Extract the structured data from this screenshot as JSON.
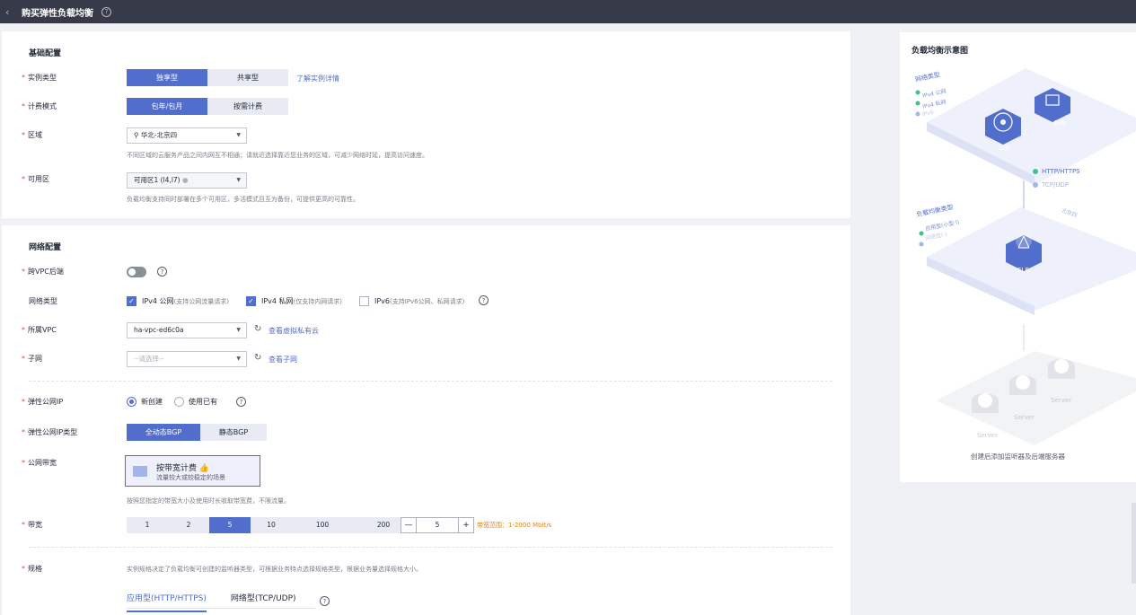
{
  "header": {
    "back": "‹",
    "title": "购买弹性负载均衡",
    "help": "?"
  },
  "basic": {
    "title": "基础配置",
    "instance_type": {
      "label": "实例类型",
      "options": [
        "独享型",
        "共享型"
      ],
      "selected": 0,
      "link": "了解实例详情"
    },
    "billing": {
      "label": "计费模式",
      "options": [
        "包年/包月",
        "按需计费"
      ],
      "selected": 0
    },
    "region": {
      "label": "区域",
      "value": "华北-北京四",
      "hint": "不同区域的云服务产品之间内网互不相通；请就近选择靠近您业务的区域，可减少网络时延，提高访问速度。"
    },
    "az": {
      "label": "可用区",
      "value": "可用区1 (l4,l7)",
      "hint": "负载均衡支持同时部署在多个可用区，多活模式且互为备份，可提供更高的可靠性。"
    }
  },
  "network": {
    "title": "网络配置",
    "cross_vpc": {
      "label": "跨VPC后端"
    },
    "net_type": {
      "label": "网络类型",
      "options": [
        {
          "label": "IPv4 公网",
          "sub": "(支持公网流量请求)",
          "checked": true
        },
        {
          "label": "IPv4 私网",
          "sub": "(仅支持内网请求)",
          "checked": true
        },
        {
          "label": "IPv6",
          "sub": "(支持IPv6公网、私网请求)",
          "checked": false
        }
      ]
    },
    "vpc": {
      "label": "所属VPC",
      "value": "ha-vpc-ed6c0a",
      "link": "查看虚拟私有云"
    },
    "subnet": {
      "label": "子网",
      "placeholder": "--请选择--",
      "link": "查看子网"
    },
    "eip": {
      "label": "弹性公网IP",
      "options": [
        "新创建",
        "使用已有"
      ],
      "selected": 0
    },
    "eip_type": {
      "label": "弹性公网IP类型",
      "options": [
        "全动态BGP",
        "静态BGP"
      ],
      "selected": 0
    },
    "bandwidth_type": {
      "label": "公网带宽",
      "card_title": "按带宽计费",
      "card_desc": "流量较大或较稳定的场景",
      "hint": "按照您指定的带宽大小及使用时长收取带宽费，不限流量。"
    },
    "bandwidth": {
      "label": "带宽",
      "options": [
        "1",
        "2",
        "5",
        "10",
        "100",
        "200"
      ],
      "selected": 2,
      "value": "5",
      "minus": "—",
      "plus": "+",
      "range": "带宽范围：1-2000 Mbit/s"
    },
    "spec": {
      "label": "规格",
      "hint": "实例规格决定了负载均衡可创建的监听器类型，可根据业务特点选择规格类型，根据业务量选择规格大小。",
      "tabs": [
        "应用型(HTTP/HTTPS)",
        "网络型(TCP/UDP)"
      ],
      "selected": 0
    }
  },
  "diagram": {
    "title": "负载均衡示意图",
    "net_type_title": "网络类型",
    "net_types": [
      "IPv4 公网",
      "IPv4 私网",
      "IPv6"
    ],
    "public_label": "公网",
    "private_label": "私网",
    "protocols": [
      "HTTP/HTTPS",
      "TCP/UDP"
    ],
    "lb_type_title": "负载均衡类型",
    "lb_types": [
      "应用型(小型 I)",
      "网络型(-)"
    ],
    "region_tag": "北京四",
    "elb_label": "ELB",
    "server_label": "Server",
    "caption": "创建后添加监听器及后端服务器",
    "colors": {
      "accent": "#526ecc",
      "green": "#3bc389",
      "platform": "#e4e8f7"
    }
  }
}
